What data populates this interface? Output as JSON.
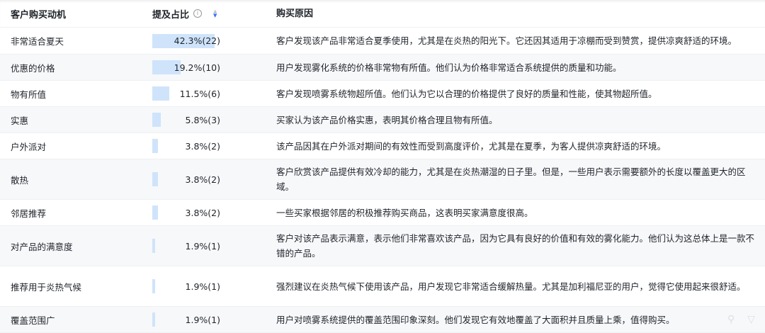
{
  "columns": {
    "motive": "客户购买动机",
    "ratio": "提及占比",
    "reason": "购买原因"
  },
  "accent": "#cfe4fb",
  "rows": [
    {
      "motive": "非常适合夏天",
      "pct": 42.3,
      "label": "42.3%(22)",
      "reason": "客户发现该产品非常适合夏季使用，尤其是在炎热的阳光下。它还因其适用于凉棚而受到赞赏，提供凉爽舒适的环境。"
    },
    {
      "motive": "优惠的价格",
      "pct": 19.2,
      "label": "19.2%(10)",
      "reason": "用户发现雾化系统的价格非常物有所值。他们认为价格非常适合系统提供的质量和功能。"
    },
    {
      "motive": "物有所值",
      "pct": 11.5,
      "label": "11.5%(6)",
      "reason": "客户发现喷雾系统物超所值。他们认为它以合理的价格提供了良好的质量和性能，使其物超所值。"
    },
    {
      "motive": "实惠",
      "pct": 5.8,
      "label": "5.8%(3)",
      "reason": "买家认为该产品价格实惠，表明其价格合理且物有所值。"
    },
    {
      "motive": "户外派对",
      "pct": 3.8,
      "label": "3.8%(2)",
      "reason": "该产品因其在户外派对期间的有效性而受到高度评价，尤其是在夏季，为客人提供凉爽舒适的环境。"
    },
    {
      "motive": "散热",
      "pct": 3.8,
      "label": "3.8%(2)",
      "reason": "客户欣赏该产品提供有效冷却的能力，尤其是在炎热潮湿的日子里。但是，一些用户表示需要额外的长度以覆盖更大的区域。"
    },
    {
      "motive": "邻居推荐",
      "pct": 3.8,
      "label": "3.8%(2)",
      "reason": "一些买家根据邻居的积极推荐购买商品，这表明买家满意度很高。"
    },
    {
      "motive": "对产品的满意度",
      "pct": 1.9,
      "label": "1.9%(1)",
      "reason": "客户对该产品表示满意，表示他们非常喜欢该产品，因为它具有良好的价值和有效的雾化能力。他们认为这总体上是一款不错的产品。"
    },
    {
      "motive": "推荐用于炎热气候",
      "pct": 1.9,
      "label": "1.9%(1)",
      "reason": "强烈建议在炎热气候下使用该产品，用户发现它非常适合缓解热量。尤其是加利福尼亚的用户，觉得它使用起来很舒适。"
    },
    {
      "motive": "覆盖范围广",
      "pct": 1.9,
      "label": "1.9%(1)",
      "reason": "用户对喷雾系统提供的覆盖范围印象深刻。他们发现它有效地覆盖了大面积并且质量上乘，值得购买。"
    }
  ]
}
